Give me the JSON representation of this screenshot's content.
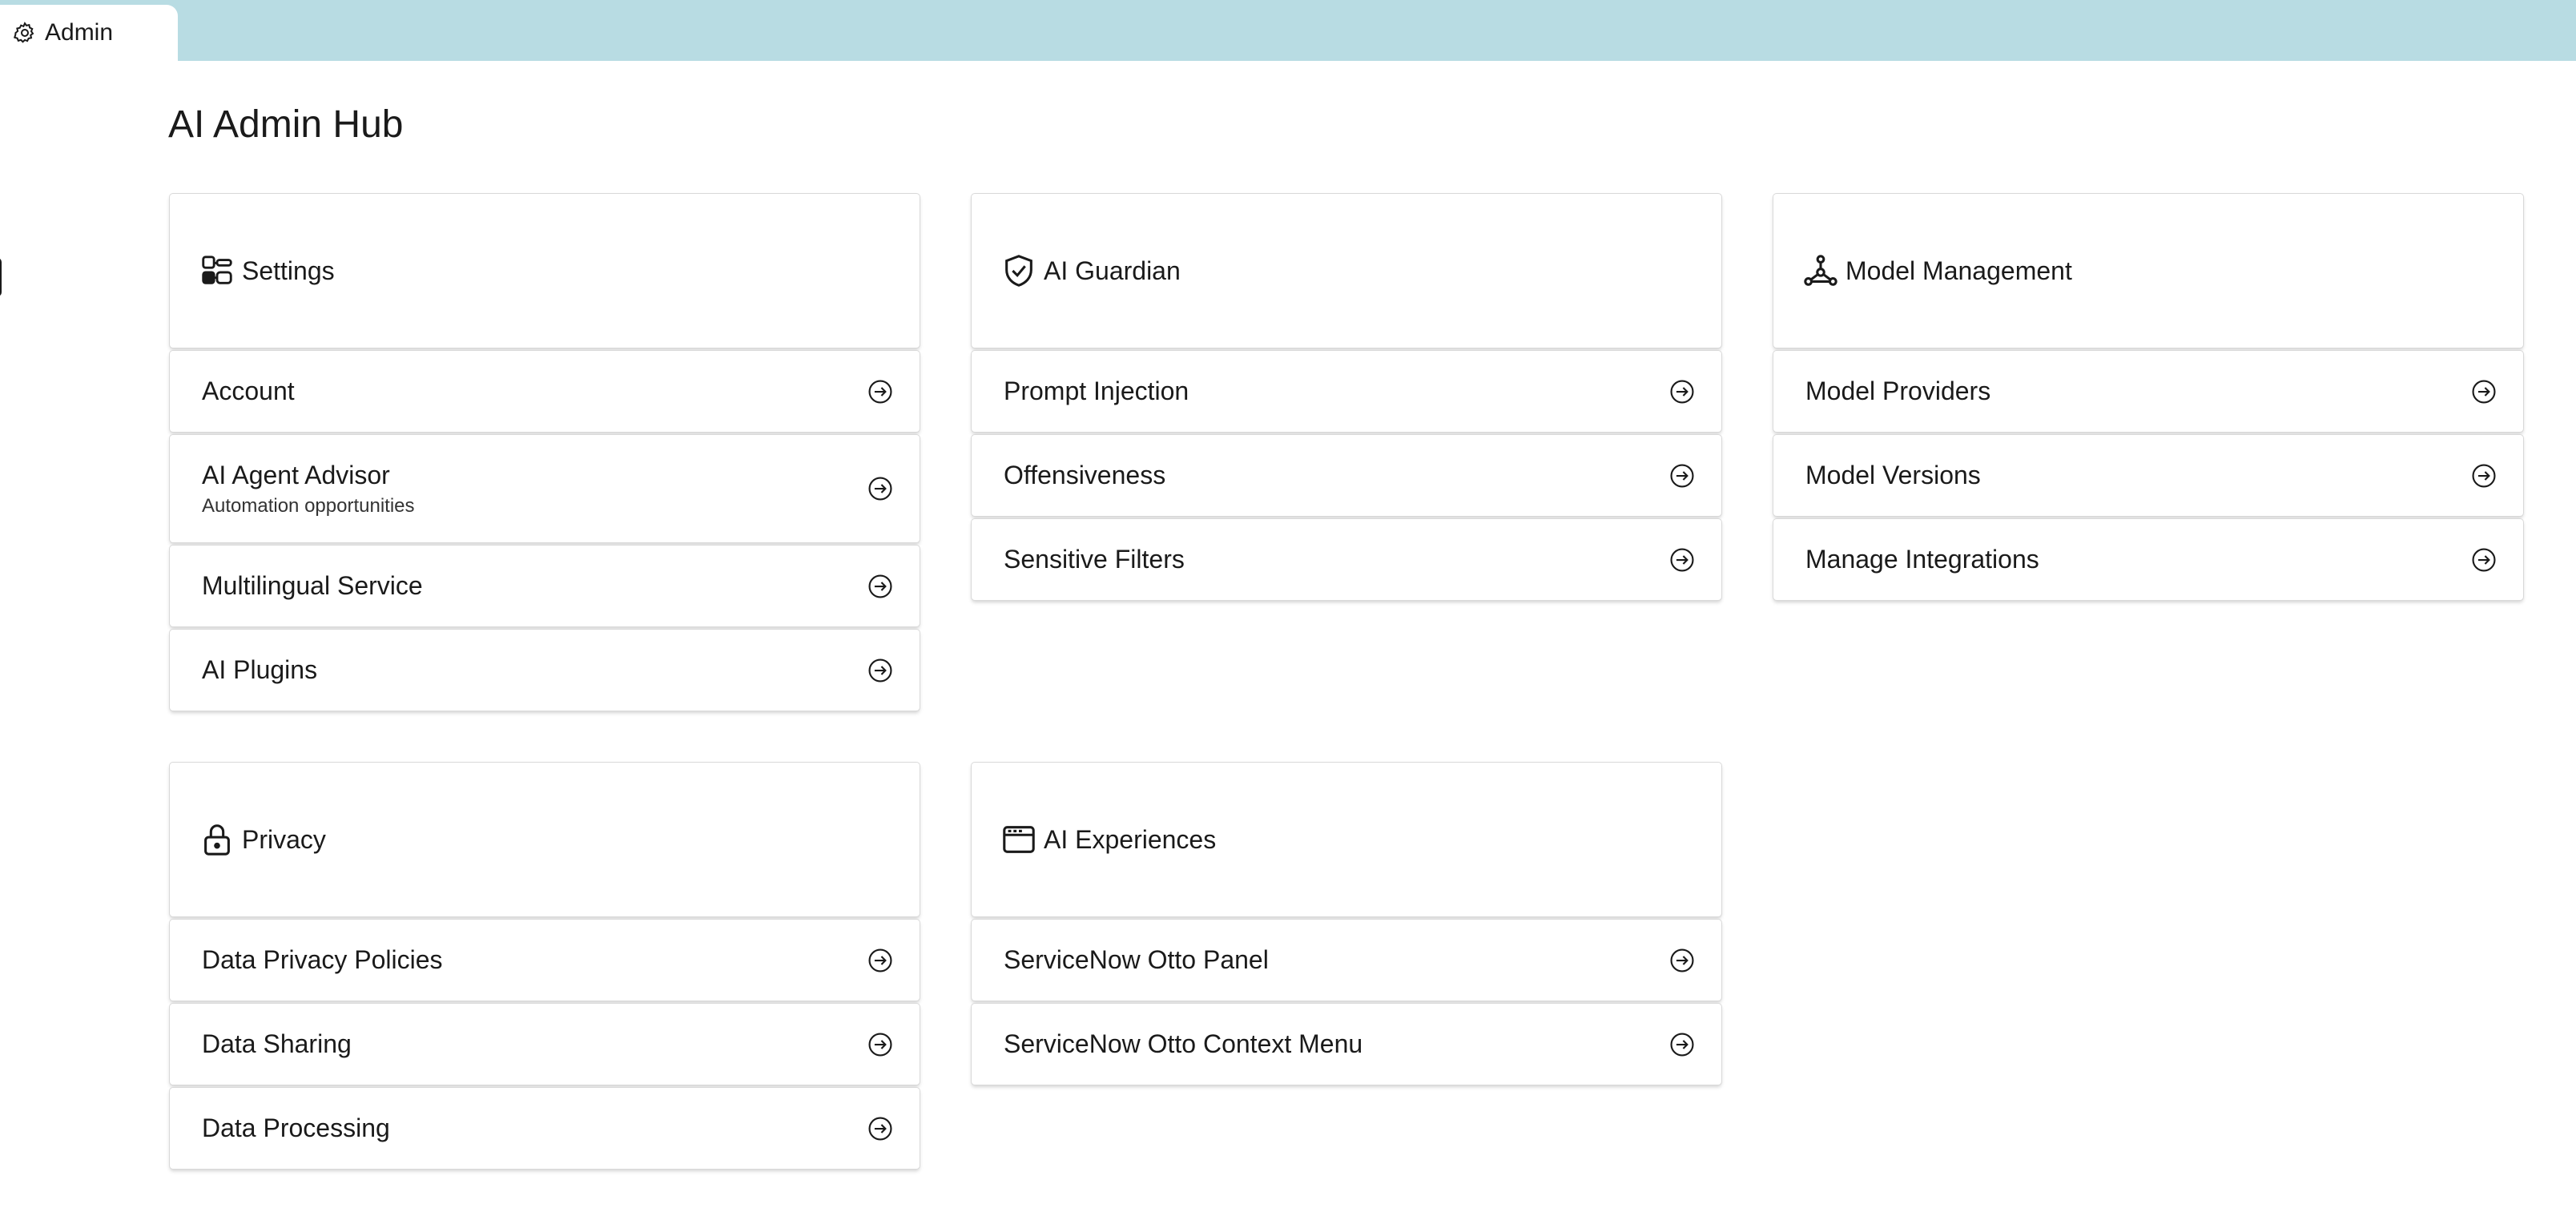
{
  "tab": {
    "label": "Admin",
    "icon": "gear-icon"
  },
  "page_title": "AI Admin Hub",
  "colors": {
    "topbar": "#b8dce3",
    "text": "#1a1a1a",
    "card_border": "#d9d9d9"
  },
  "cards": {
    "settings": {
      "title": "Settings",
      "icon": "toggles-icon",
      "items": [
        {
          "label": "Account"
        },
        {
          "label": "AI Agent Advisor",
          "sub": "Automation opportunities"
        },
        {
          "label": "Multilingual Service"
        },
        {
          "label": "AI Plugins"
        }
      ]
    },
    "guardian": {
      "title": "AI Guardian",
      "icon": "shield-check-icon",
      "items": [
        {
          "label": "Prompt Injection"
        },
        {
          "label": "Offensiveness"
        },
        {
          "label": "Sensitive Filters"
        }
      ]
    },
    "model": {
      "title": "Model Management",
      "icon": "network-nodes-icon",
      "items": [
        {
          "label": "Model Providers"
        },
        {
          "label": "Model Versions"
        },
        {
          "label": "Manage Integrations"
        }
      ]
    },
    "privacy": {
      "title": "Privacy",
      "icon": "lock-icon",
      "items": [
        {
          "label": "Data Privacy Policies"
        },
        {
          "label": "Data Sharing"
        },
        {
          "label": "Data Processing"
        }
      ]
    },
    "experiences": {
      "title": "AI Experiences",
      "icon": "browser-window-icon",
      "items": [
        {
          "label": "ServiceNow Otto Panel"
        },
        {
          "label": "ServiceNow Otto Context Menu"
        }
      ]
    }
  }
}
